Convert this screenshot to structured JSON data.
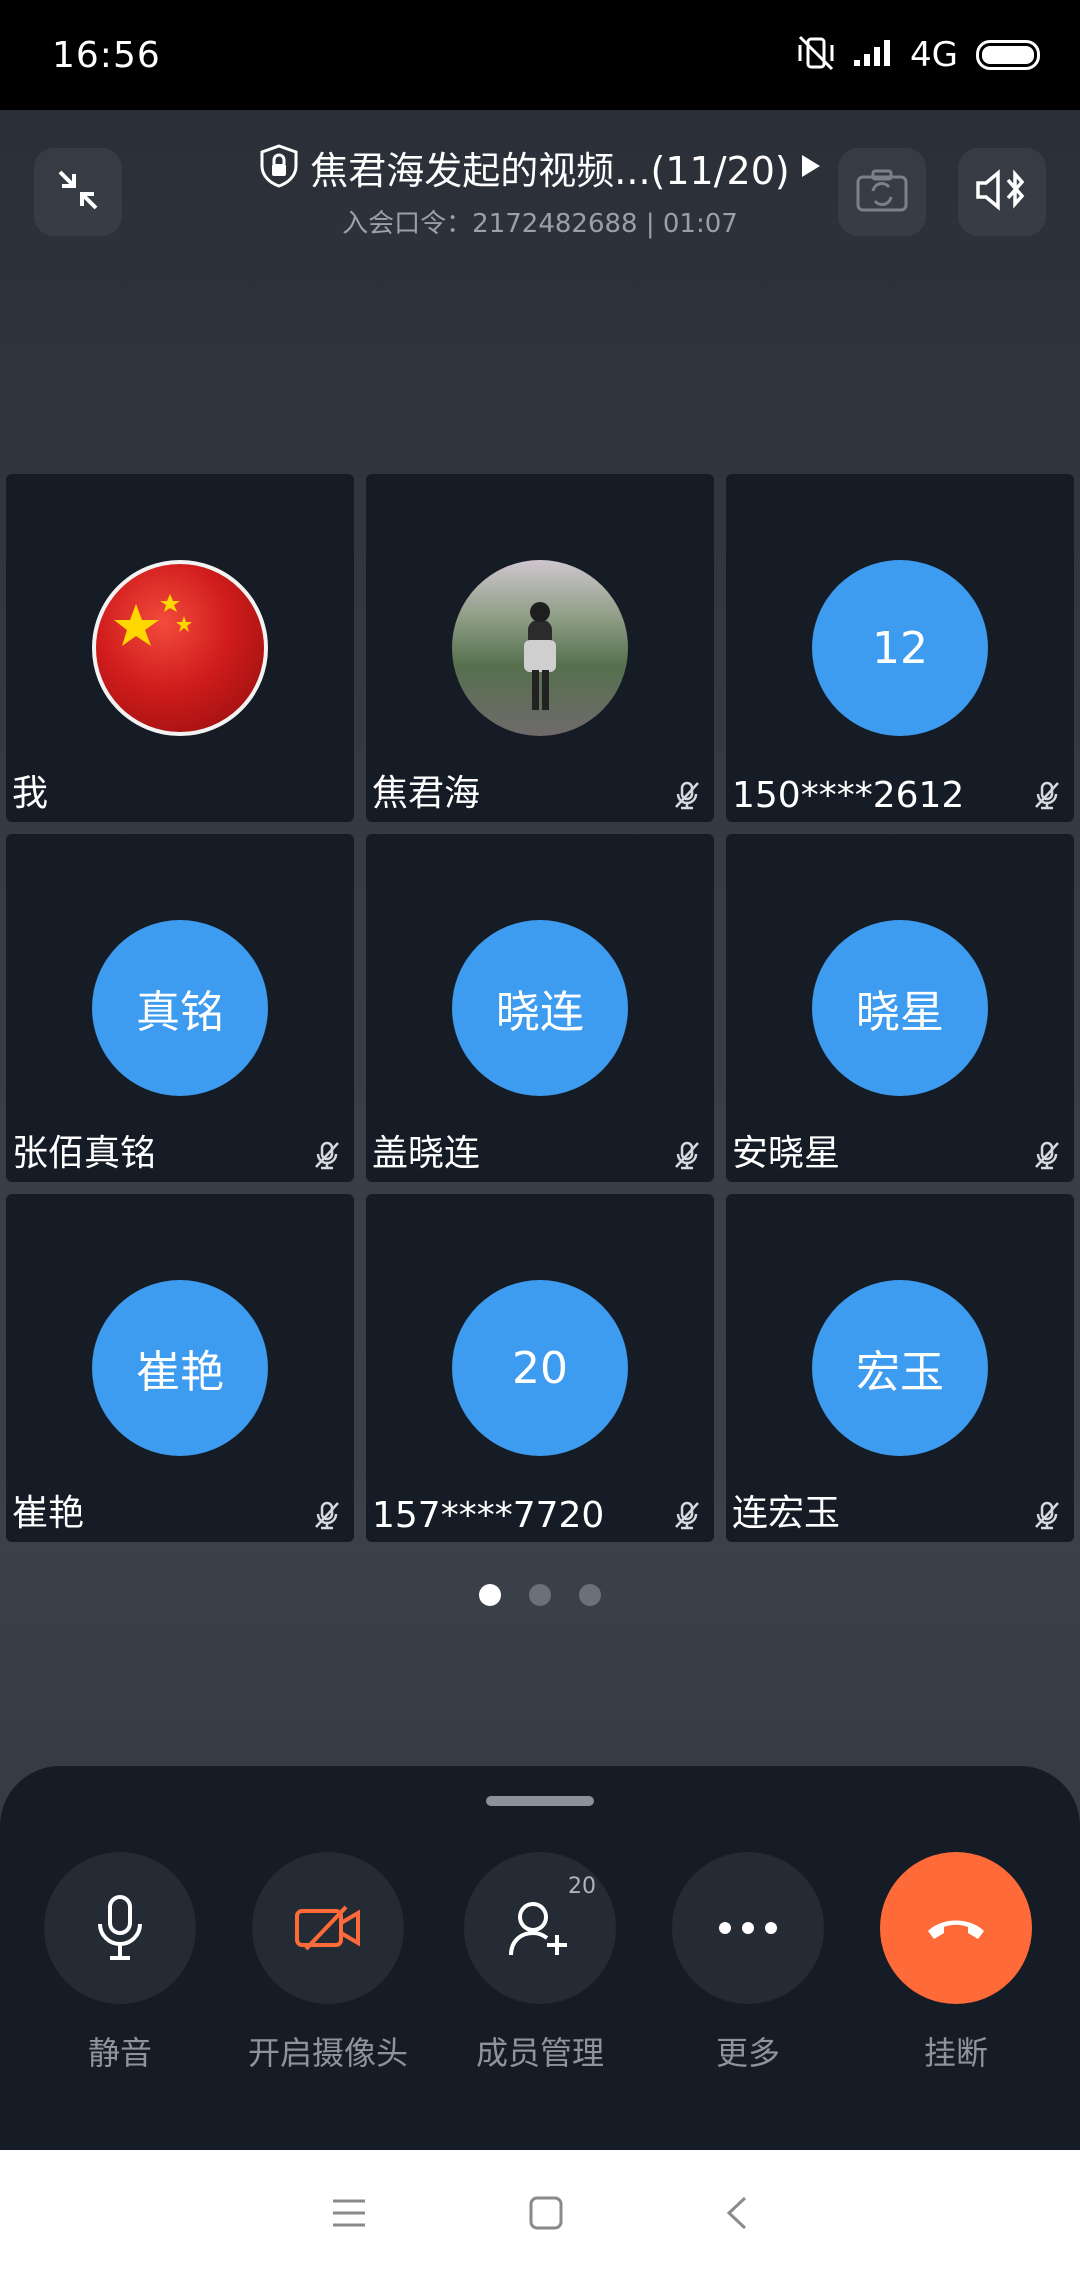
{
  "status_bar": {
    "time": "16:56",
    "network": "4G"
  },
  "header": {
    "title": "焦君海发起的视频...(11/20)",
    "subtitle": "入会口令：2172482688 | 01:07"
  },
  "participants": [
    {
      "name": "我",
      "avatar_text": "",
      "avatar_type": "flag-image",
      "muted": false
    },
    {
      "name": "焦君海",
      "avatar_text": "",
      "avatar_type": "photo",
      "muted": true
    },
    {
      "name": "150****2612",
      "avatar_text": "12",
      "avatar_type": "initials",
      "muted": true
    },
    {
      "name": "张佰真铭",
      "avatar_text": "真铭",
      "avatar_type": "initials",
      "muted": true
    },
    {
      "name": "盖晓连",
      "avatar_text": "晓连",
      "avatar_type": "initials",
      "muted": true
    },
    {
      "name": "安晓星",
      "avatar_text": "晓星",
      "avatar_type": "initials",
      "muted": true
    },
    {
      "name": "崔艳",
      "avatar_text": "崔艳",
      "avatar_type": "initials",
      "muted": true
    },
    {
      "name": "157****7720",
      "avatar_text": "20",
      "avatar_type": "initials",
      "muted": true
    },
    {
      "name": "连宏玉",
      "avatar_text": "宏玉",
      "avatar_type": "initials",
      "muted": true
    }
  ],
  "pager": {
    "pages": 3,
    "current": 1
  },
  "controls": {
    "mute_label": "静音",
    "camera_label": "开启摄像头",
    "members_label": "成员管理",
    "members_count": "20",
    "more_label": "更多",
    "hangup_label": "挂断"
  },
  "colors": {
    "avatar_blue": "#3d9bf0",
    "hangup_orange": "#ff6a39",
    "camera_off_orange": "#ff6a39"
  }
}
